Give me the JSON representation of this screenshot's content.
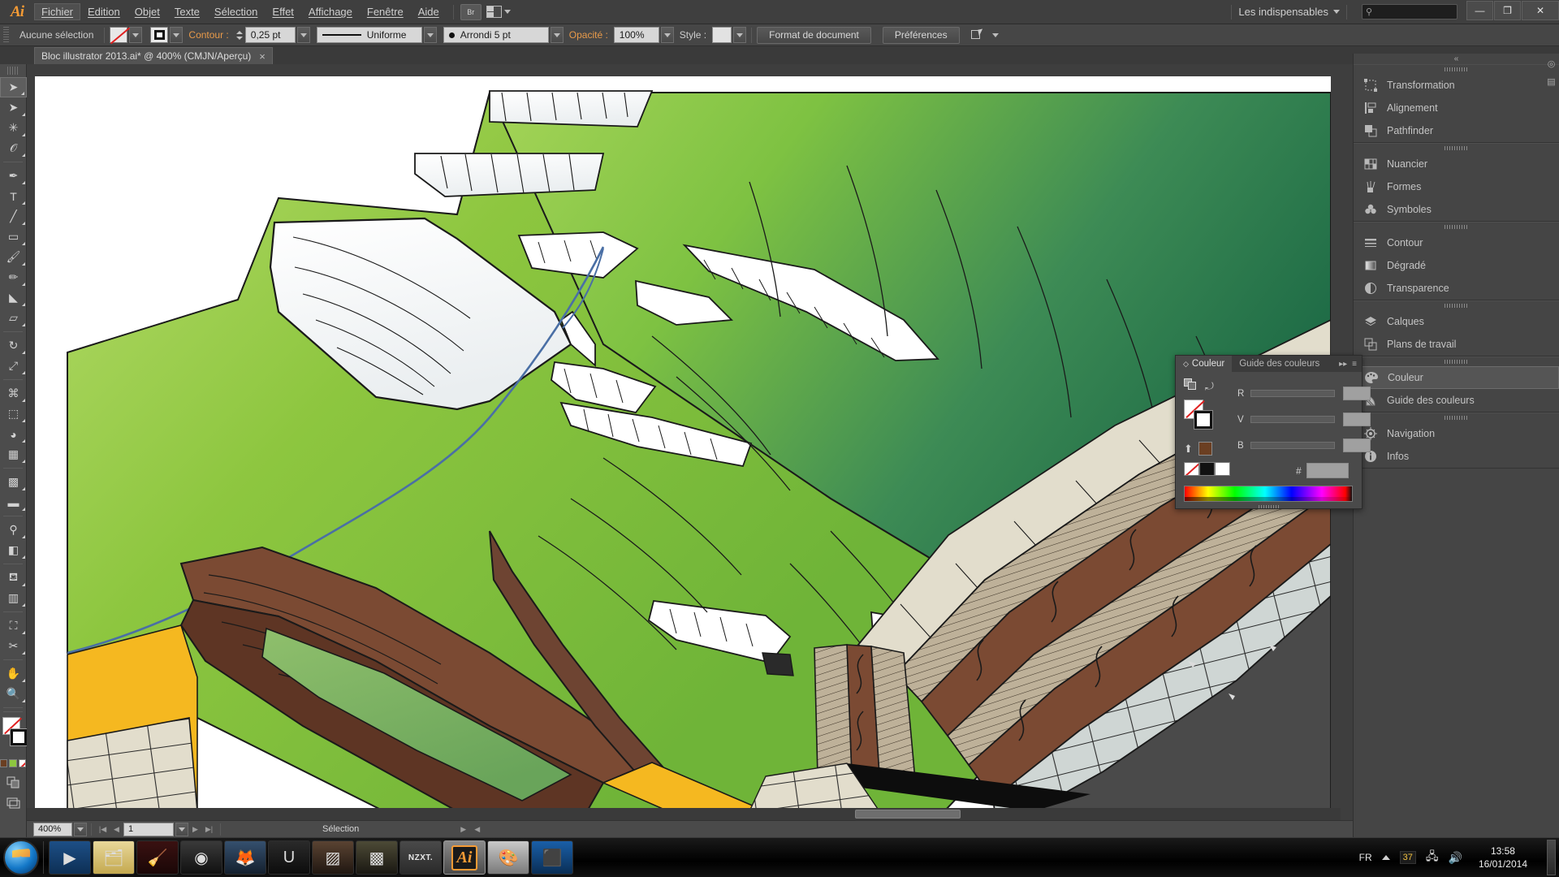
{
  "app": {
    "name": "Adobe Illustrator",
    "logo_text": "Ai",
    "workspace": "Les indispensables",
    "search_placeholder": "",
    "bridge_label": "Br"
  },
  "menubar": {
    "items": [
      {
        "label": "Fichier",
        "mnemonic": "F",
        "active": true
      },
      {
        "label": "Edition",
        "mnemonic": "E",
        "active": false
      },
      {
        "label": "Objet",
        "mnemonic": "O",
        "active": false
      },
      {
        "label": "Texte",
        "mnemonic": "x",
        "active": false
      },
      {
        "label": "Sélection",
        "mnemonic": "S",
        "active": false
      },
      {
        "label": "Effet",
        "mnemonic": "f",
        "active": false
      },
      {
        "label": "Affichage",
        "mnemonic": "A",
        "active": false
      },
      {
        "label": "Fenêtre",
        "mnemonic": "n",
        "active": false
      },
      {
        "label": "Aide",
        "mnemonic": "d",
        "active": false
      }
    ]
  },
  "window_controls": {
    "minimize": "—",
    "restore": "❐",
    "close": "✕"
  },
  "controlbar": {
    "selection_status": "Aucune sélection",
    "fill_label": "Fond",
    "stroke_label": "Contour :",
    "stroke_weight": "0,25 pt",
    "stroke_profile": "Uniforme",
    "brush": "Arrondi 5 pt",
    "opacity_label": "Opacité :",
    "opacity_value": "100%",
    "style_label": "Style :",
    "document_setup_button": "Format de document",
    "preferences_button": "Préférences"
  },
  "document": {
    "tab_title": "Bloc illustrator 2013.ai* @ 400% (CMJN/Aperçu)",
    "close_glyph": "×"
  },
  "toolbar": {
    "tools": [
      {
        "name": "selection-tool",
        "glyph": "➤",
        "selected": true
      },
      {
        "name": "direct-selection-tool",
        "glyph": "➤",
        "selected": false
      },
      {
        "name": "magic-wand-tool",
        "glyph": "✳",
        "selected": false
      },
      {
        "name": "lasso-tool",
        "glyph": "𝒪",
        "selected": false
      },
      {
        "name": "pen-tool",
        "glyph": "✒",
        "selected": false
      },
      {
        "name": "type-tool",
        "glyph": "T",
        "selected": false
      },
      {
        "name": "line-segment-tool",
        "glyph": "╱",
        "selected": false
      },
      {
        "name": "rectangle-tool",
        "glyph": "▭",
        "selected": false
      },
      {
        "name": "paintbrush-tool",
        "glyph": "🖌",
        "selected": false
      },
      {
        "name": "pencil-tool",
        "glyph": "✏",
        "selected": false
      },
      {
        "name": "blob-brush-tool",
        "glyph": "◣",
        "selected": false
      },
      {
        "name": "eraser-tool",
        "glyph": "▱",
        "selected": false
      },
      {
        "name": "rotate-tool",
        "glyph": "↻",
        "selected": false
      },
      {
        "name": "scale-tool",
        "glyph": "⤢",
        "selected": false
      },
      {
        "name": "width-tool",
        "glyph": "⌘",
        "selected": false
      },
      {
        "name": "free-transform-tool",
        "glyph": "⬚",
        "selected": false
      },
      {
        "name": "shape-builder-tool",
        "glyph": "◕",
        "selected": false
      },
      {
        "name": "perspective-grid-tool",
        "glyph": "▦",
        "selected": false
      },
      {
        "name": "mesh-tool",
        "glyph": "▩",
        "selected": false
      },
      {
        "name": "gradient-tool",
        "glyph": "▬",
        "selected": false
      },
      {
        "name": "eyedropper-tool",
        "glyph": "⚲",
        "selected": false
      },
      {
        "name": "blend-tool",
        "glyph": "◧",
        "selected": false
      },
      {
        "name": "symbol-sprayer-tool",
        "glyph": "⛾",
        "selected": false
      },
      {
        "name": "column-graph-tool",
        "glyph": "▥",
        "selected": false
      },
      {
        "name": "artboard-tool",
        "glyph": "⛶",
        "selected": false
      },
      {
        "name": "slice-tool",
        "glyph": "✂",
        "selected": false
      },
      {
        "name": "hand-tool",
        "glyph": "✋",
        "selected": false
      },
      {
        "name": "zoom-tool",
        "glyph": "🔍",
        "selected": false
      }
    ]
  },
  "statusbar": {
    "zoom_level": "400%",
    "page_number": "1",
    "status_text": "Sélection"
  },
  "dock": {
    "groups": [
      {
        "items": [
          {
            "label": "Transformation",
            "icon": "transform-icon",
            "active": false
          },
          {
            "label": "Alignement",
            "icon": "align-icon",
            "active": false
          },
          {
            "label": "Pathfinder",
            "icon": "pathfinder-icon",
            "active": false
          }
        ]
      },
      {
        "items": [
          {
            "label": "Nuancier",
            "icon": "swatches-icon",
            "active": false
          },
          {
            "label": "Formes",
            "icon": "brushes-icon",
            "active": false
          },
          {
            "label": "Symboles",
            "icon": "symbols-icon",
            "active": false
          }
        ]
      },
      {
        "items": [
          {
            "label": "Contour",
            "icon": "stroke-icon",
            "active": false
          },
          {
            "label": "Dégradé",
            "icon": "gradient-icon",
            "active": false
          },
          {
            "label": "Transparence",
            "icon": "transparency-icon",
            "active": false
          }
        ]
      },
      {
        "items": [
          {
            "label": "Calques",
            "icon": "layers-icon",
            "active": false
          },
          {
            "label": "Plans de travail",
            "icon": "artboards-icon",
            "active": false
          }
        ]
      },
      {
        "items": [
          {
            "label": "Couleur",
            "icon": "color-icon",
            "active": true
          },
          {
            "label": "Guide des couleurs",
            "icon": "color-guide-icon",
            "active": false
          }
        ]
      },
      {
        "items": [
          {
            "label": "Navigation",
            "icon": "navigator-icon",
            "active": false
          },
          {
            "label": "Infos",
            "icon": "info-icon",
            "active": false
          }
        ]
      }
    ]
  },
  "color_panel": {
    "tabs": [
      {
        "label": "Couleur",
        "active": true
      },
      {
        "label": "Guide des couleurs",
        "active": false
      }
    ],
    "channels": [
      {
        "label": "R",
        "value": ""
      },
      {
        "label": "V",
        "value": ""
      },
      {
        "label": "B",
        "value": ""
      }
    ],
    "hex_label": "#",
    "hex_value": "",
    "recent_swatch": "#6B3F22",
    "none_label": "Sans",
    "black_label": "Noir",
    "white_label": "Blanc"
  },
  "artwork": {
    "description": "Bloc-diagramme géologique 3D",
    "palette": {
      "grass_light": "#8DC63F",
      "grass_mid": "#7DBF3C",
      "grass_dark": "#2F7A4B",
      "grass_deep": "#1E6B46",
      "snow": "#FFFFFF",
      "snow_shadow": "#E4E8EA",
      "brown_rock": "#7B4A33",
      "brown_dark": "#5E3524",
      "brown_mid": "#6E4432",
      "sand_tan": "#BEB199",
      "cream": "#E2DDCC",
      "pale_grey": "#CFD6D4",
      "dark_grey": "#4A4A4A",
      "yellow": "#F5B820",
      "river_blue": "#4A6FA5",
      "outline": "#1A1A1A"
    }
  },
  "taskbar": {
    "apps": [
      {
        "name": "media-player",
        "glyph": "▶",
        "active": false
      },
      {
        "name": "windows-explorer",
        "glyph": "🗂",
        "active": false
      },
      {
        "name": "ccleaner",
        "glyph": "🧹",
        "active": false
      },
      {
        "name": "steam",
        "glyph": "◉",
        "active": false
      },
      {
        "name": "firefox",
        "glyph": "🦊",
        "active": false
      },
      {
        "name": "ubisoft-game",
        "glyph": "U",
        "active": false
      },
      {
        "name": "game-thumbnail-1",
        "glyph": "▨",
        "active": false
      },
      {
        "name": "game-thumbnail-2",
        "glyph": "▩",
        "active": false
      },
      {
        "name": "nzxt-cam",
        "glyph": "NZXT.",
        "active": false
      },
      {
        "name": "adobe-illustrator",
        "glyph": "Ai",
        "active": true
      },
      {
        "name": "paint-app",
        "glyph": "🎨",
        "active": false
      },
      {
        "name": "driver-booster",
        "glyph": "⬛",
        "active": false
      }
    ],
    "tray": {
      "language": "FR",
      "network_badge": "37",
      "time": "13:58",
      "date": "16/01/2014"
    }
  }
}
